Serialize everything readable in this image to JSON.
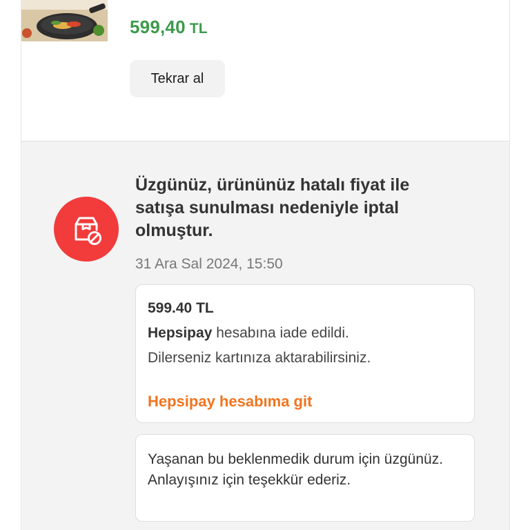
{
  "product": {
    "price_value": "599,40",
    "price_currency": "TL",
    "rebuy_label": "Tekrar al"
  },
  "notice": {
    "title": "Üzgünüz, ürününüz hatalı fiyat ile satışa sunulması nedeniyle iptal olmuştur.",
    "date": "31 Ara Sal 2024, 15:50",
    "icon": "package-cancel-icon",
    "icon_color": "#f23b3b"
  },
  "refund": {
    "amount": "599.40 TL",
    "provider": "Hepsipay",
    "line1_rest": " hesabına iade edildi.",
    "line2": "Dilerseniz kartınıza aktarabilirsiniz.",
    "link_label": "Hepsipay hesabıma git",
    "link_color": "#f2741f"
  },
  "apology": {
    "text": "Yaşanan bu beklenmedik durum için üzgünüz. Anlayışınız için teşekkür ederiz."
  },
  "colors": {
    "price": "#3d9a4b",
    "section_bg": "#f3f3f3"
  }
}
